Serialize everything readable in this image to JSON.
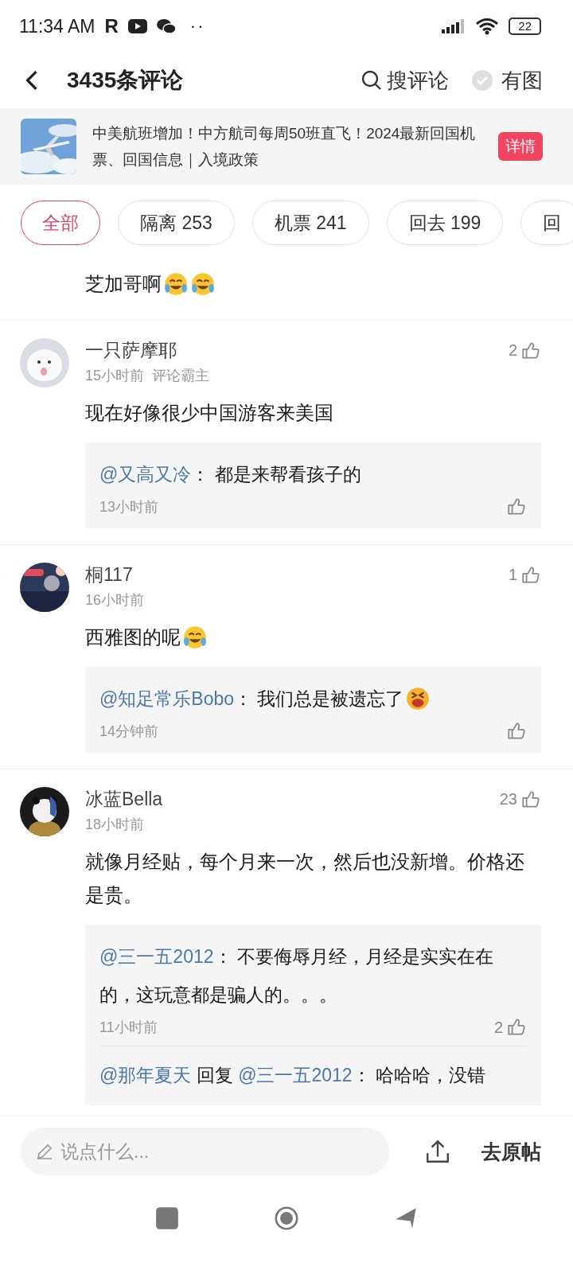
{
  "status_bar": {
    "time": "11:34 AM",
    "app_letter": "R",
    "dots": "··",
    "battery": "22"
  },
  "header": {
    "title": "3435条评论",
    "search_label": "搜评论",
    "image_filter": {
      "label": "有图",
      "checked": false
    }
  },
  "banner": {
    "thumbnail": {
      "kind": "picture"
    },
    "text": "中美航班增加！中方航司每周50班直飞！2024最新回国机票、回国信息｜入境政策",
    "button": "详情"
  },
  "tags": [
    {
      "label": "全部",
      "selected": true
    },
    {
      "label": "隔离 253",
      "selected": false
    },
    {
      "label": "机票 241",
      "selected": false
    },
    {
      "label": "回去 199",
      "selected": false
    },
    {
      "label": "回",
      "selected": false
    }
  ],
  "partial_comment": {
    "text": "芝加哥啊",
    "emoji": [
      {
        "kind": "tears_of_joy"
      },
      {
        "kind": "tears_of_joy"
      }
    ]
  },
  "comments": [
    {
      "avatar": {
        "kind": "picture"
      },
      "author": "一只萨摩耶",
      "time": "15小时前",
      "badge": "评论霸主",
      "likes": "2",
      "text": "现在好像很少中国游客来美国",
      "replies": [
        {
          "mention": "@又高又冷",
          "text": "：  都是来帮看孩子的",
          "time": "13小时前"
        }
      ]
    },
    {
      "avatar": {
        "kind": "picture"
      },
      "author": "桐117",
      "time": "16小时前",
      "likes": "1",
      "text": "西雅图的呢",
      "emoji": [
        {
          "kind": "tears_of_joy"
        }
      ],
      "replies": [
        {
          "mention": "@知足常乐Bobo",
          "text": "：  我们总是被遗忘了",
          "emoji": [
            {
              "kind": "crying_angry"
            }
          ],
          "time": "14分钟前"
        }
      ]
    },
    {
      "avatar": {
        "kind": "picture"
      },
      "author": "冰蓝Bella",
      "time": "18小时前",
      "likes": "23",
      "text": "就像月经贴，每个月来一次，然后也没新增。价格还是贵。",
      "replies": [
        {
          "mention": "@三一五2012",
          "text": "：  不要侮辱月经，月经是实实在在的，这玩意都是骗人的。。。",
          "time": "11小时前",
          "likes": "2"
        },
        {
          "mention": "@那年夏天",
          "reply_word": "回复",
          "reply_to": "@三一五2012",
          "text": "：  哈哈哈，没错"
        }
      ]
    }
  ],
  "composer": {
    "placeholder": "说点什么...",
    "go_button": "去原帖"
  }
}
